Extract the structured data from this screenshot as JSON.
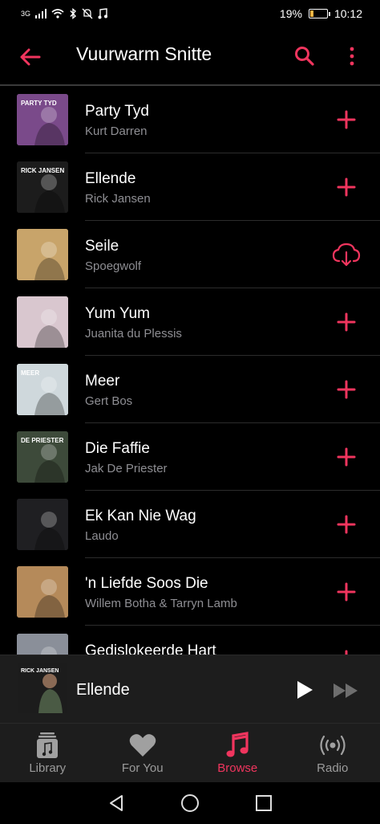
{
  "status_bar": {
    "network": "3G",
    "battery_percent": "19%",
    "battery_level": 0.19,
    "time": "10:12"
  },
  "header": {
    "title": "Vuurwarm Snitte",
    "accent_color": "#f0355e"
  },
  "songs": [
    {
      "title": "Party Tyd",
      "artist": "Kurt Darren",
      "action": "add",
      "art_text": "PARTY TYD",
      "art_bg": "#7a4a8a"
    },
    {
      "title": "Ellende",
      "artist": "Rick Jansen",
      "action": "add",
      "art_text": "RICK JANSEN",
      "art_bg": "#1c1c1c"
    },
    {
      "title": "Seile",
      "artist": "Spoegwolf",
      "action": "download",
      "art_text": "",
      "art_bg": "#c8a46a"
    },
    {
      "title": "Yum Yum",
      "artist": "Juanita du Plessis",
      "action": "add",
      "art_text": "",
      "art_bg": "#d9c7cf"
    },
    {
      "title": "Meer",
      "artist": "Gert Bos",
      "action": "add",
      "art_text": "MEER",
      "art_bg": "#cfd8dc"
    },
    {
      "title": "Die Faffie",
      "artist": "Jak De Priester",
      "action": "add",
      "art_text": "DE PRIESTER",
      "art_bg": "#3d4a3a"
    },
    {
      "title": "Ek Kan Nie Wag",
      "artist": "Laudo",
      "action": "add",
      "art_text": "",
      "art_bg": "#1f1f22"
    },
    {
      "title": "'n Liefde Soos Die",
      "artist": "Willem Botha & Tarryn Lamb",
      "action": "add",
      "art_text": "",
      "art_bg": "#b58a5a"
    },
    {
      "title": "Gedislokeerde Hart",
      "artist": "",
      "action": "add",
      "art_text": "",
      "art_bg": "#8a8f99"
    }
  ],
  "now_playing": {
    "title": "Ellende",
    "art_text": "RICK JANSEN"
  },
  "tabs": [
    {
      "label": "Library",
      "icon": "library-icon",
      "active": false
    },
    {
      "label": "For You",
      "icon": "heart-icon",
      "active": false
    },
    {
      "label": "Browse",
      "icon": "music-note-icon",
      "active": true
    },
    {
      "label": "Radio",
      "icon": "radio-icon",
      "active": false
    }
  ]
}
